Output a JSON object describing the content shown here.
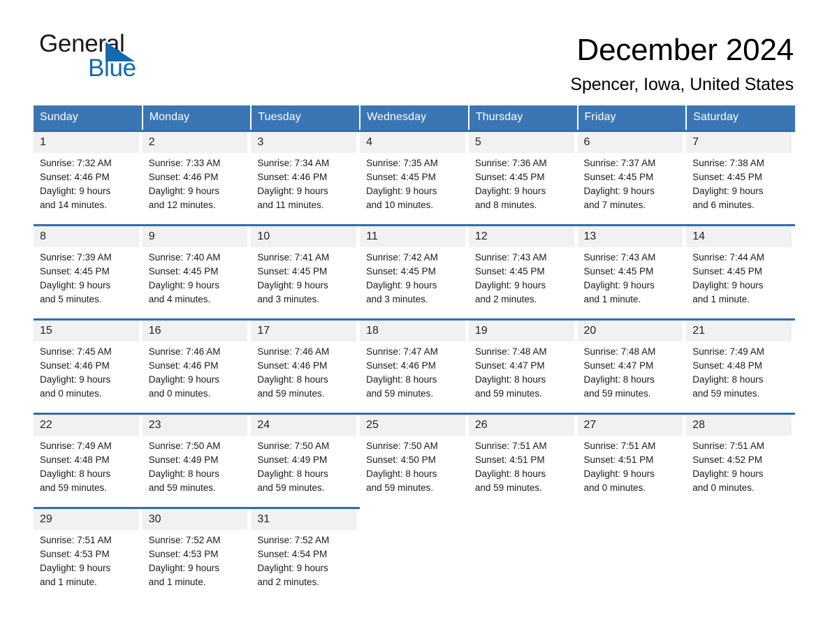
{
  "brand": {
    "name_top": "General",
    "name_bottom": "Blue",
    "accent_color": "#1469b0"
  },
  "header": {
    "title": "December 2024",
    "subtitle": "Spencer, Iowa, United States"
  },
  "theme": {
    "header_row_bg": "#3b76b4",
    "week_rule": "#2f6eae",
    "daynum_bg": "#f1f1f1",
    "text": "#1a1a1a"
  },
  "weekday_headers": [
    "Sunday",
    "Monday",
    "Tuesday",
    "Wednesday",
    "Thursday",
    "Friday",
    "Saturday"
  ],
  "labels": {
    "sunrise": "Sunrise:",
    "sunset": "Sunset:",
    "daylight": "Daylight:"
  },
  "weeks": [
    [
      {
        "day": "1",
        "sunrise": "Sunrise: 7:32 AM",
        "sunset": "Sunset: 4:46 PM",
        "daylight_line1": "Daylight: 9 hours",
        "daylight_line2": "and 14 minutes."
      },
      {
        "day": "2",
        "sunrise": "Sunrise: 7:33 AM",
        "sunset": "Sunset: 4:46 PM",
        "daylight_line1": "Daylight: 9 hours",
        "daylight_line2": "and 12 minutes."
      },
      {
        "day": "3",
        "sunrise": "Sunrise: 7:34 AM",
        "sunset": "Sunset: 4:46 PM",
        "daylight_line1": "Daylight: 9 hours",
        "daylight_line2": "and 11 minutes."
      },
      {
        "day": "4",
        "sunrise": "Sunrise: 7:35 AM",
        "sunset": "Sunset: 4:45 PM",
        "daylight_line1": "Daylight: 9 hours",
        "daylight_line2": "and 10 minutes."
      },
      {
        "day": "5",
        "sunrise": "Sunrise: 7:36 AM",
        "sunset": "Sunset: 4:45 PM",
        "daylight_line1": "Daylight: 9 hours",
        "daylight_line2": "and 8 minutes."
      },
      {
        "day": "6",
        "sunrise": "Sunrise: 7:37 AM",
        "sunset": "Sunset: 4:45 PM",
        "daylight_line1": "Daylight: 9 hours",
        "daylight_line2": "and 7 minutes."
      },
      {
        "day": "7",
        "sunrise": "Sunrise: 7:38 AM",
        "sunset": "Sunset: 4:45 PM",
        "daylight_line1": "Daylight: 9 hours",
        "daylight_line2": "and 6 minutes."
      }
    ],
    [
      {
        "day": "8",
        "sunrise": "Sunrise: 7:39 AM",
        "sunset": "Sunset: 4:45 PM",
        "daylight_line1": "Daylight: 9 hours",
        "daylight_line2": "and 5 minutes."
      },
      {
        "day": "9",
        "sunrise": "Sunrise: 7:40 AM",
        "sunset": "Sunset: 4:45 PM",
        "daylight_line1": "Daylight: 9 hours",
        "daylight_line2": "and 4 minutes."
      },
      {
        "day": "10",
        "sunrise": "Sunrise: 7:41 AM",
        "sunset": "Sunset: 4:45 PM",
        "daylight_line1": "Daylight: 9 hours",
        "daylight_line2": "and 3 minutes."
      },
      {
        "day": "11",
        "sunrise": "Sunrise: 7:42 AM",
        "sunset": "Sunset: 4:45 PM",
        "daylight_line1": "Daylight: 9 hours",
        "daylight_line2": "and 3 minutes."
      },
      {
        "day": "12",
        "sunrise": "Sunrise: 7:43 AM",
        "sunset": "Sunset: 4:45 PM",
        "daylight_line1": "Daylight: 9 hours",
        "daylight_line2": "and 2 minutes."
      },
      {
        "day": "13",
        "sunrise": "Sunrise: 7:43 AM",
        "sunset": "Sunset: 4:45 PM",
        "daylight_line1": "Daylight: 9 hours",
        "daylight_line2": "and 1 minute."
      },
      {
        "day": "14",
        "sunrise": "Sunrise: 7:44 AM",
        "sunset": "Sunset: 4:45 PM",
        "daylight_line1": "Daylight: 9 hours",
        "daylight_line2": "and 1 minute."
      }
    ],
    [
      {
        "day": "15",
        "sunrise": "Sunrise: 7:45 AM",
        "sunset": "Sunset: 4:46 PM",
        "daylight_line1": "Daylight: 9 hours",
        "daylight_line2": "and 0 minutes."
      },
      {
        "day": "16",
        "sunrise": "Sunrise: 7:46 AM",
        "sunset": "Sunset: 4:46 PM",
        "daylight_line1": "Daylight: 9 hours",
        "daylight_line2": "and 0 minutes."
      },
      {
        "day": "17",
        "sunrise": "Sunrise: 7:46 AM",
        "sunset": "Sunset: 4:46 PM",
        "daylight_line1": "Daylight: 8 hours",
        "daylight_line2": "and 59 minutes."
      },
      {
        "day": "18",
        "sunrise": "Sunrise: 7:47 AM",
        "sunset": "Sunset: 4:46 PM",
        "daylight_line1": "Daylight: 8 hours",
        "daylight_line2": "and 59 minutes."
      },
      {
        "day": "19",
        "sunrise": "Sunrise: 7:48 AM",
        "sunset": "Sunset: 4:47 PM",
        "daylight_line1": "Daylight: 8 hours",
        "daylight_line2": "and 59 minutes."
      },
      {
        "day": "20",
        "sunrise": "Sunrise: 7:48 AM",
        "sunset": "Sunset: 4:47 PM",
        "daylight_line1": "Daylight: 8 hours",
        "daylight_line2": "and 59 minutes."
      },
      {
        "day": "21",
        "sunrise": "Sunrise: 7:49 AM",
        "sunset": "Sunset: 4:48 PM",
        "daylight_line1": "Daylight: 8 hours",
        "daylight_line2": "and 59 minutes."
      }
    ],
    [
      {
        "day": "22",
        "sunrise": "Sunrise: 7:49 AM",
        "sunset": "Sunset: 4:48 PM",
        "daylight_line1": "Daylight: 8 hours",
        "daylight_line2": "and 59 minutes."
      },
      {
        "day": "23",
        "sunrise": "Sunrise: 7:50 AM",
        "sunset": "Sunset: 4:49 PM",
        "daylight_line1": "Daylight: 8 hours",
        "daylight_line2": "and 59 minutes."
      },
      {
        "day": "24",
        "sunrise": "Sunrise: 7:50 AM",
        "sunset": "Sunset: 4:49 PM",
        "daylight_line1": "Daylight: 8 hours",
        "daylight_line2": "and 59 minutes."
      },
      {
        "day": "25",
        "sunrise": "Sunrise: 7:50 AM",
        "sunset": "Sunset: 4:50 PM",
        "daylight_line1": "Daylight: 8 hours",
        "daylight_line2": "and 59 minutes."
      },
      {
        "day": "26",
        "sunrise": "Sunrise: 7:51 AM",
        "sunset": "Sunset: 4:51 PM",
        "daylight_line1": "Daylight: 8 hours",
        "daylight_line2": "and 59 minutes."
      },
      {
        "day": "27",
        "sunrise": "Sunrise: 7:51 AM",
        "sunset": "Sunset: 4:51 PM",
        "daylight_line1": "Daylight: 9 hours",
        "daylight_line2": "and 0 minutes."
      },
      {
        "day": "28",
        "sunrise": "Sunrise: 7:51 AM",
        "sunset": "Sunset: 4:52 PM",
        "daylight_line1": "Daylight: 9 hours",
        "daylight_line2": "and 0 minutes."
      }
    ],
    [
      {
        "day": "29",
        "sunrise": "Sunrise: 7:51 AM",
        "sunset": "Sunset: 4:53 PM",
        "daylight_line1": "Daylight: 9 hours",
        "daylight_line2": "and 1 minute."
      },
      {
        "day": "30",
        "sunrise": "Sunrise: 7:52 AM",
        "sunset": "Sunset: 4:53 PM",
        "daylight_line1": "Daylight: 9 hours",
        "daylight_line2": "and 1 minute."
      },
      {
        "day": "31",
        "sunrise": "Sunrise: 7:52 AM",
        "sunset": "Sunset: 4:54 PM",
        "daylight_line1": "Daylight: 9 hours",
        "daylight_line2": "and 2 minutes."
      },
      {
        "day": "",
        "sunrise": "",
        "sunset": "",
        "daylight_line1": "",
        "daylight_line2": ""
      },
      {
        "day": "",
        "sunrise": "",
        "sunset": "",
        "daylight_line1": "",
        "daylight_line2": ""
      },
      {
        "day": "",
        "sunrise": "",
        "sunset": "",
        "daylight_line1": "",
        "daylight_line2": ""
      },
      {
        "day": "",
        "sunrise": "",
        "sunset": "",
        "daylight_line1": "",
        "daylight_line2": ""
      }
    ]
  ]
}
